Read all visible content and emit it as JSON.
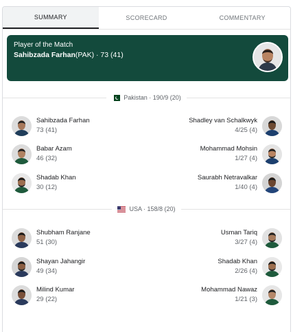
{
  "tabs": [
    {
      "label": "SUMMARY",
      "active": true
    },
    {
      "label": "SCORECARD",
      "active": false
    },
    {
      "label": "COMMENTARY",
      "active": false
    }
  ],
  "player_of_match": {
    "label": "Player of the Match",
    "name": "Sahibzada Farhan",
    "team": "(PAK)",
    "score": " · 73 (41)"
  },
  "innings": [
    {
      "team_line": "Pakistan · 190/9 (20)",
      "flag": "pakistan-flag-icon",
      "batters": [
        {
          "name": "Sahibzada Farhan",
          "stat": "73 (41)"
        },
        {
          "name": "Babar Azam",
          "stat": "46 (32)"
        },
        {
          "name": "Shadab Khan",
          "stat": "30 (12)"
        }
      ],
      "bowlers": [
        {
          "name": "Shadley van Schalkwyk",
          "stat": "4/25 (4)"
        },
        {
          "name": "Mohammad Mohsin",
          "stat": "1/27 (4)"
        },
        {
          "name": "Saurabh Netravalkar",
          "stat": "1/40 (4)"
        }
      ]
    },
    {
      "team_line": "USA · 158/8 (20)",
      "flag": "usa-flag-icon",
      "batters": [
        {
          "name": "Shubham Ranjane",
          "stat": "51 (30)"
        },
        {
          "name": "Shayan Jahangir",
          "stat": "49 (34)"
        },
        {
          "name": "Milind Kumar",
          "stat": "29 (22)"
        }
      ],
      "bowlers": [
        {
          "name": "Usman Tariq",
          "stat": "3/27 (4)"
        },
        {
          "name": "Shadab Khan",
          "stat": "2/26 (4)"
        },
        {
          "name": "Mohammad Nawaz",
          "stat": "1/21 (3)"
        }
      ]
    }
  ],
  "colors": {
    "pom_bg": "#134a3c",
    "pakistan_green": "#01411c",
    "usa_red": "#b22234",
    "usa_blue": "#3c3b6e"
  }
}
